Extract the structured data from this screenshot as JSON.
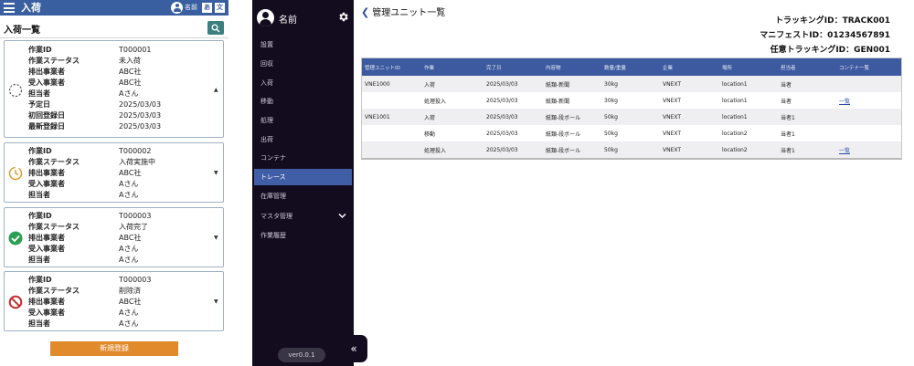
{
  "mobile": {
    "header": {
      "title": "入荷",
      "user_name": "名前"
    },
    "list_title": "入荷一覧",
    "cards": [
      {
        "status": "not-started",
        "fields": [
          {
            "label": "作業ID",
            "value": "T000001"
          },
          {
            "label": "作業ステータス",
            "value": "未入荷"
          },
          {
            "label": "排出事業者",
            "value": "ABC社"
          },
          {
            "label": "受入事業者",
            "value": "ABC社"
          },
          {
            "label": "担当者",
            "value": "Aさん"
          },
          {
            "label": "予定日",
            "value": "2025/03/03"
          },
          {
            "label": "初回登録日",
            "value": "2025/03/03"
          },
          {
            "label": "最新登録日",
            "value": "2025/03/03"
          }
        ]
      },
      {
        "status": "in-progress",
        "fields": [
          {
            "label": "作業ID",
            "value": "T000002"
          },
          {
            "label": "作業ステータス",
            "value": "入荷実施中"
          },
          {
            "label": "排出事業者",
            "value": "ABC社"
          },
          {
            "label": "受入事業者",
            "value": "Aさん"
          },
          {
            "label": "担当者",
            "value": "Aさん"
          }
        ]
      },
      {
        "status": "completed",
        "fields": [
          {
            "label": "作業ID",
            "value": "T000003"
          },
          {
            "label": "作業ステータス",
            "value": "入荷完了"
          },
          {
            "label": "排出事業者",
            "value": "ABC社"
          },
          {
            "label": "受入事業者",
            "value": "Aさん"
          },
          {
            "label": "担当者",
            "value": "Aさん"
          }
        ]
      },
      {
        "status": "deleted",
        "fields": [
          {
            "label": "作業ID",
            "value": "T000003"
          },
          {
            "label": "作業ステータス",
            "value": "削除済"
          },
          {
            "label": "排出事業者",
            "value": "ABC社"
          },
          {
            "label": "受入事業者",
            "value": "Aさん"
          },
          {
            "label": "担当者",
            "value": "Aさん"
          }
        ]
      }
    ],
    "new_button": "新規登録"
  },
  "sidebar": {
    "user_name": "名前",
    "items": [
      {
        "label": "設置"
      },
      {
        "label": "回収"
      },
      {
        "label": "入荷"
      },
      {
        "label": "移動"
      },
      {
        "label": "処理"
      },
      {
        "label": "出荷"
      },
      {
        "label": "コンテナ"
      },
      {
        "label": "トレース",
        "active": true
      },
      {
        "label": "在庫管理"
      },
      {
        "label": "マスタ管理",
        "expandable": true
      },
      {
        "label": "作業履歴"
      }
    ],
    "version": "ver0.0.1"
  },
  "main": {
    "title": "管理ユニット一覧",
    "tracking": [
      {
        "text": "トラッキングID：TRACK001"
      },
      {
        "text": "マニフェストID：01234567891"
      },
      {
        "text": "任意トラッキングID：GEN001"
      }
    ],
    "table": {
      "columns": [
        "管理ユニットID",
        "作業",
        "完了日",
        "内容物",
        "数量/重量",
        "企業",
        "場所",
        "担当者",
        "コンテナ一覧"
      ],
      "rows": [
        [
          "VNE1000",
          "入荷",
          "2025/03/03",
          "紙類-新聞",
          "30kg",
          "VNEXT",
          "location1",
          "当者",
          ""
        ],
        [
          "",
          "処理投入",
          "2025/03/03",
          "紙類-新聞",
          "30kg",
          "VNEXT",
          "location1",
          "当者",
          "一覧"
        ],
        [
          "VNE1001",
          "入荷",
          "2025/03/03",
          "紙類-段ボール",
          "50kg",
          "VNEXT",
          "location1",
          "当者1",
          ""
        ],
        [
          "",
          "移動",
          "2025/03/03",
          "紙類-段ボール",
          "50kg",
          "VNEXT",
          "location2",
          "当者1",
          ""
        ],
        [
          "",
          "処理投入",
          "2025/03/03",
          "紙類-段ボール",
          "50kg",
          "VNEXT",
          "location2",
          "当者1",
          "一覧"
        ]
      ]
    }
  },
  "colors": {
    "header_blue": "#3a5fa0",
    "sidebar_bg": "#130c1f",
    "active_item": "#3f5ea6",
    "table_header": "#3d5aa0",
    "new_button": "#e08a2b",
    "search_button": "#3d7f7e",
    "status_in_progress": "#d99a22",
    "status_completed": "#2e9e52",
    "status_deleted": "#c62b2b"
  }
}
